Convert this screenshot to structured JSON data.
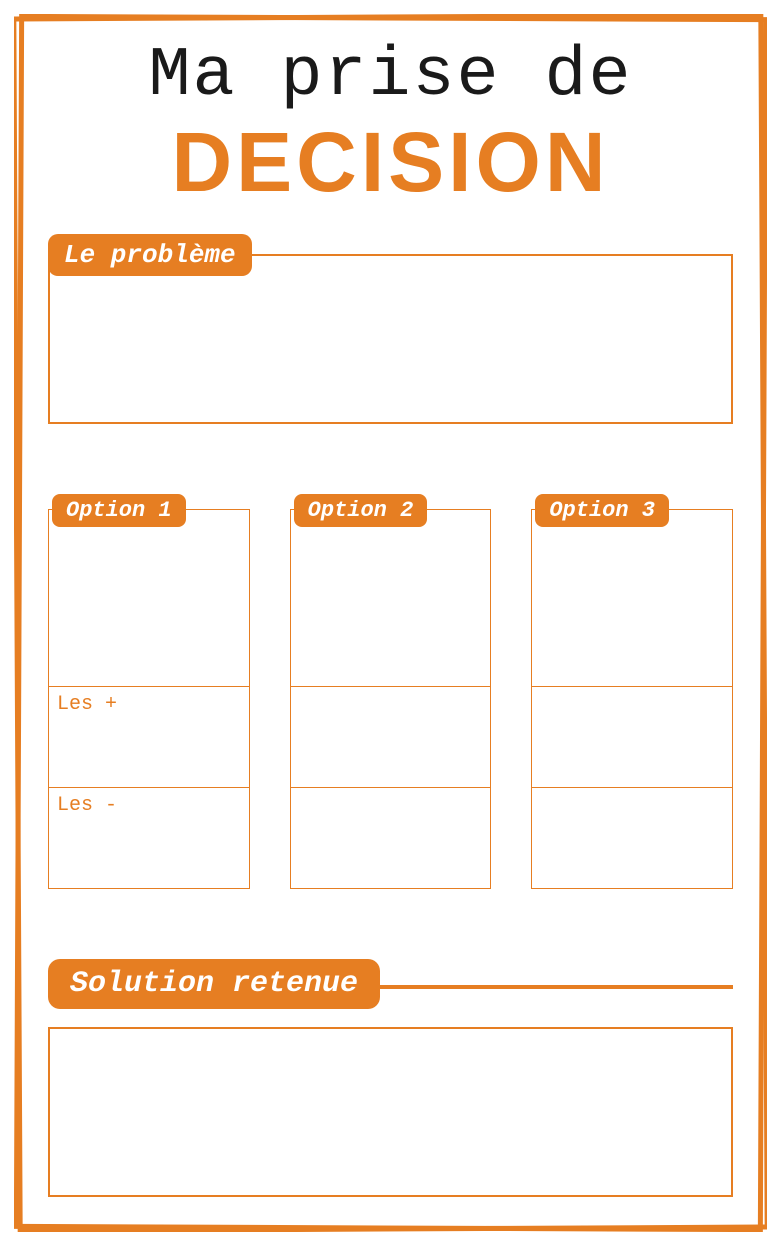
{
  "title": {
    "line1": "Ma prise de",
    "line2": "DECISION"
  },
  "problem": {
    "label": "Le problème"
  },
  "options": [
    {
      "label": "Option 1",
      "plus_label": "Les +",
      "minus_label": "Les -"
    },
    {
      "label": "Option 2",
      "plus_label": "",
      "minus_label": ""
    },
    {
      "label": "Option 3",
      "plus_label": "",
      "minus_label": ""
    }
  ],
  "solution": {
    "label": "Solution retenue"
  },
  "colors": {
    "accent": "#e67e22"
  }
}
